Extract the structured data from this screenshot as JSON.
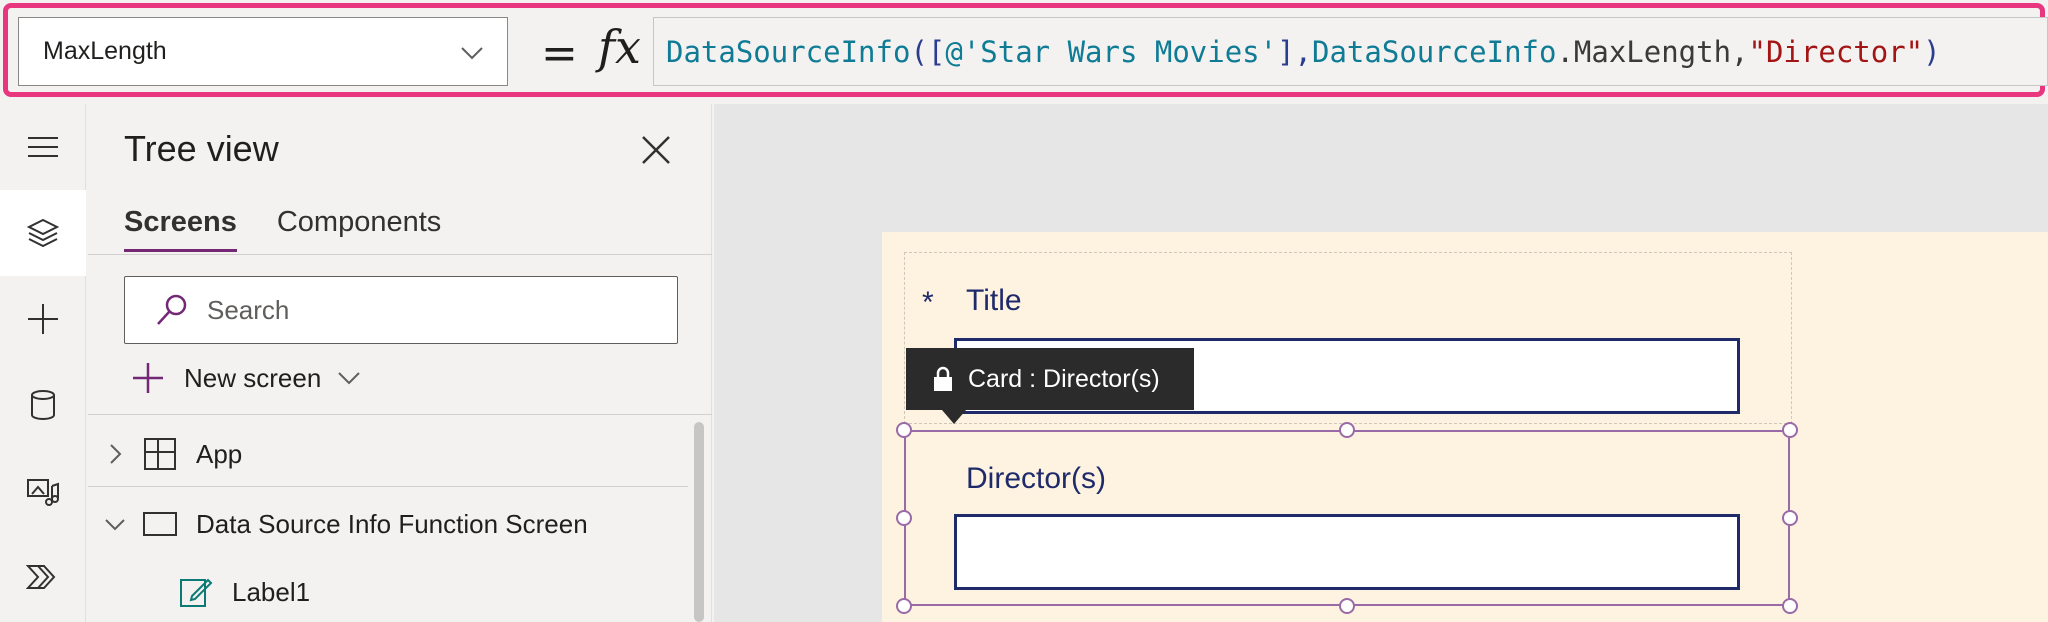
{
  "formula_bar": {
    "property": "MaxLength",
    "equals": "=",
    "fx": "fx",
    "formula_tokens": [
      {
        "text": "DataSourceInfo",
        "kind": "fn"
      },
      {
        "text": "([",
        "kind": "punc"
      },
      {
        "text": "@'Star Wars Movies'",
        "kind": "fn"
      },
      {
        "text": "], ",
        "kind": "punc"
      },
      {
        "text": "DataSourceInfo",
        "kind": "fn"
      },
      {
        "text": ".MaxLength, ",
        "kind": "plain"
      },
      {
        "text": "\"Director\"",
        "kind": "str"
      },
      {
        "text": ")",
        "kind": "punc"
      }
    ]
  },
  "rail": {
    "items": [
      {
        "name": "hamburger-icon"
      },
      {
        "name": "layers-icon",
        "active": true
      },
      {
        "name": "insert-plus-icon"
      },
      {
        "name": "data-cylinder-icon"
      },
      {
        "name": "media-icon"
      },
      {
        "name": "power-automate-icon"
      }
    ]
  },
  "tree": {
    "title": "Tree view",
    "tabs": [
      {
        "label": "Screens",
        "active": true
      },
      {
        "label": "Components",
        "active": false
      }
    ],
    "search_placeholder": "Search",
    "new_screen_label": "New screen",
    "rows": [
      {
        "label": "App",
        "expanded": false,
        "icon": "app-grid-icon"
      },
      {
        "label": "Data Source Info Function Screen",
        "expanded": true,
        "icon": "screen-icon"
      },
      {
        "label": "Label1",
        "icon": "label-edit-icon"
      }
    ]
  },
  "canvas": {
    "required_marker": "*",
    "title_label": "Title",
    "tooltip": "Card : Director(s)",
    "director_label": "Director(s)"
  },
  "colors": {
    "formula_border": "#e8367f",
    "accent_purple": "#742774",
    "selection": "#9a6aa6",
    "field_border": "#1f2a6b",
    "screen_bg": "#fdf3e0"
  }
}
